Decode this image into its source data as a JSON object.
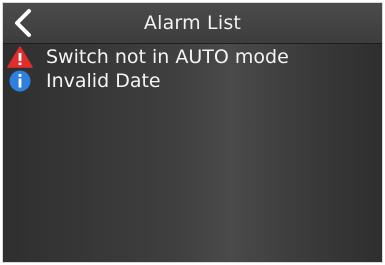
{
  "header": {
    "title": "Alarm List",
    "back_icon": "chevron-left-icon"
  },
  "alarms": [
    {
      "text": "Switch not in AUTO mode",
      "icon": "warning-triangle-icon",
      "color": "#e22d2d"
    },
    {
      "text": "Invalid Date",
      "icon": "info-circle-icon",
      "color": "#2f7fe0"
    }
  ]
}
